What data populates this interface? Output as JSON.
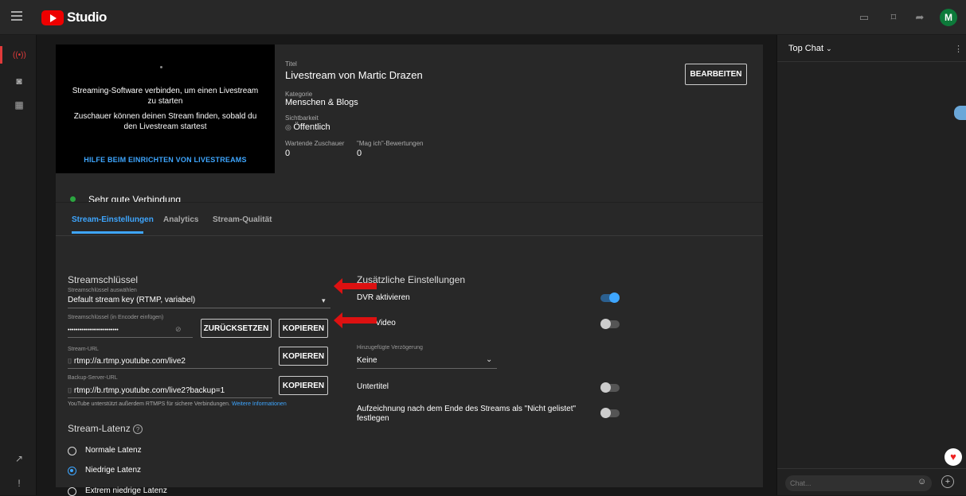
{
  "header": {
    "brand": "Studio"
  },
  "stream": {
    "preview_lines": [
      "Streaming-Software verbinden, um einen Livestream zu starten",
      "Zuschauer können deinen Stream finden, sobald du den Livestream startest"
    ],
    "help_link": "HILFE BEIM EINRICHTEN VON LIVESTREAMS",
    "title_label": "Titel",
    "title": "Livestream von Martic Drazen",
    "category_label": "Kategorie",
    "category": "Menschen & Blogs",
    "visibility_label": "Sichtbarkeit",
    "visibility": "Öffentlich",
    "waiting_label": "Wartende Zuschauer",
    "waiting": "0",
    "likes_label": "\"Mag ich\"-Bewertungen",
    "likes": "0",
    "edit_label": "BEARBEITEN",
    "connection": "Sehr gute Verbindung"
  },
  "tabs": [
    {
      "label": "Stream-Einstellungen",
      "active": true
    },
    {
      "label": "Analytics",
      "active": false
    },
    {
      "label": "Stream-Qualität",
      "active": false
    }
  ],
  "settings": {
    "key_section": "Streamschlüssel",
    "key_select_label": "Streamschlüssel auswählen",
    "key_select_value": "Default stream key (RTMP, variabel)",
    "key_field_label": "Streamschlüssel (in Encoder einfügen)",
    "key_field_value": "••••••••••••••••••••••••••",
    "reset_label": "ZURÜCKSETZEN",
    "copy_label": "KOPIEREN",
    "url_label": "Stream-URL",
    "url_value": "rtmp://a.rtmp.youtube.com/live2",
    "backup_label": "Backup-Server-URL",
    "backup_value": "rtmp://b.rtmp.youtube.com/live2?backup=1",
    "rtmps_note": "YouTube unterstützt außerdem RTMPS für sichere Verbindungen.",
    "rtmps_link": "Weitere Informationen",
    "latency_section": "Stream-Latenz",
    "latency_options": [
      {
        "label": "Normale Latenz",
        "selected": false
      },
      {
        "label": "Niedrige Latenz",
        "selected": true
      },
      {
        "label": "Extrem niedrige Latenz",
        "selected": false
      }
    ]
  },
  "extra": {
    "section": "Zusätzliche Einstellungen",
    "dvr_label": "DVR aktivieren",
    "dvr_on": true,
    "video_label": "Video",
    "video_on": false,
    "delay_label": "Hinzugefügte Verzögerung",
    "delay_value": "Keine",
    "subtitles_label": "Untertitel",
    "subtitles_on": false,
    "unlisted_label": "Aufzeichnung nach dem Ende des Streams als \"Nicht gelistet\" festlegen",
    "unlisted_on": false
  },
  "chat": {
    "header": "Top Chat",
    "placeholder": "Chat..."
  },
  "colors": {
    "accent": "#3ea6ff",
    "brand": "#ff0000",
    "status_good": "#2ba640",
    "annotation_arrow": "#dd1111"
  }
}
